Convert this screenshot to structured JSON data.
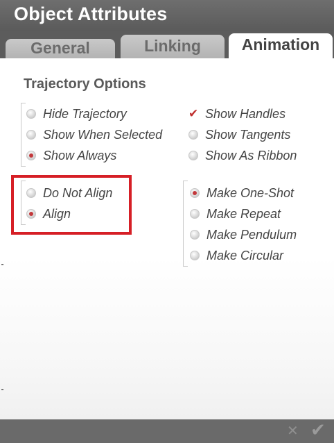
{
  "window": {
    "title": "Object Attributes"
  },
  "tabs": [
    {
      "label": "General"
    },
    {
      "label": "Linking"
    },
    {
      "label": "Animation",
      "active": true
    }
  ],
  "section": {
    "title": "Trajectory Options"
  },
  "trajectory_display": [
    {
      "label": "Hide Trajectory",
      "selected": false
    },
    {
      "label": "Show When Selected",
      "selected": false
    },
    {
      "label": "Show Always",
      "selected": true
    }
  ],
  "trajectory_extras": [
    {
      "label": "Show Handles",
      "checked": true
    },
    {
      "label": "Show Tangents",
      "checked": false
    },
    {
      "label": "Show As Ribbon",
      "checked": false
    }
  ],
  "alignment": [
    {
      "label": "Do Not Align",
      "selected": false
    },
    {
      "label": "Align",
      "selected": true
    }
  ],
  "motion_type": [
    {
      "label": "Make One-Shot",
      "selected": true
    },
    {
      "label": "Make Repeat",
      "selected": false
    },
    {
      "label": "Make Pendulum",
      "selected": false
    },
    {
      "label": "Make Circular",
      "selected": false
    }
  ],
  "footer": {
    "cancel_icon": "x-icon",
    "ok_icon": "checkmark-icon"
  },
  "colors": {
    "accent_red": "#c2383b",
    "highlight_box": "#d61f26",
    "chrome_gray": "#5c5c5c"
  }
}
